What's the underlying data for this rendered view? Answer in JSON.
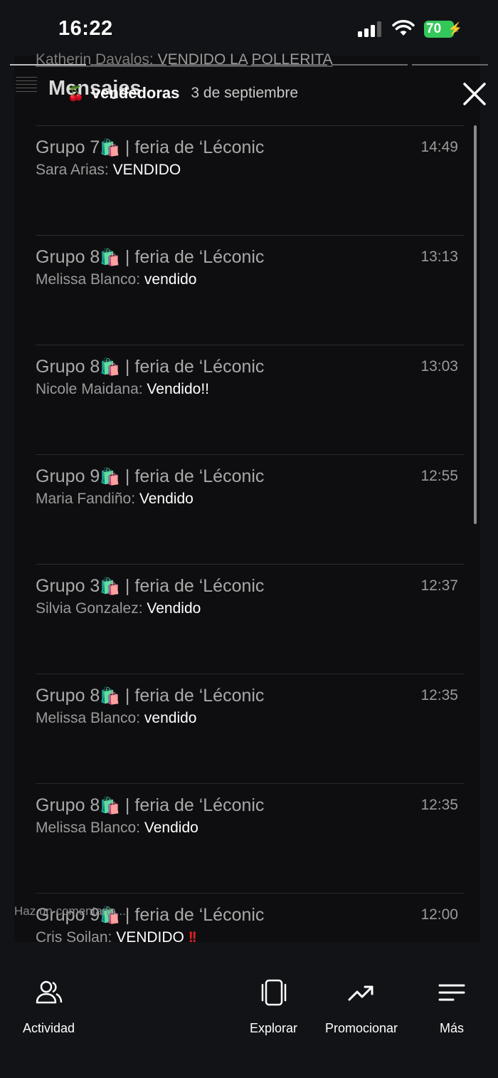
{
  "status": {
    "time": "16:22",
    "battery": "70"
  },
  "background_preview": {
    "sender": "Katherin Davalos:",
    "text": "VENDIDO LA POLLERITA"
  },
  "header": {
    "overlay_title": "Mensajes",
    "group_icon": "🍒",
    "group_name": "vendedoras",
    "date": "3 de septiembre"
  },
  "messages": [
    {
      "group": "Grupo 7",
      "bag": "🛍️",
      "suffix": " | feria de ‘Léconic",
      "time": "14:49",
      "sender": "Sara Arias: ",
      "text": "VENDIDO",
      "mark": ""
    },
    {
      "group": "Grupo 8",
      "bag": "🛍️",
      "suffix": " | feria de ‘Léconic",
      "time": "13:13",
      "sender": "Melissa Blanco: ",
      "text": "vendido",
      "mark": ""
    },
    {
      "group": "Grupo 8",
      "bag": "🛍️",
      "suffix": " | feria de ‘Léconic",
      "time": "13:03",
      "sender": "Nicole Maidana: ",
      "text": "Vendido!!",
      "mark": ""
    },
    {
      "group": "Grupo 9",
      "bag": "🛍️",
      "suffix": " | feria de ‘Léconic",
      "time": "12:55",
      "sender": "Maria Fandiño: ",
      "text": "Vendido",
      "mark": ""
    },
    {
      "group": "Grupo 3",
      "bag": "🛍️",
      "suffix": " | feria de ‘Léconic",
      "time": "12:37",
      "sender": "Silvia Gonzalez: ",
      "text": "Vendido",
      "mark": ""
    },
    {
      "group": "Grupo 8",
      "bag": "🛍️",
      "suffix": " | feria de ‘Léconic",
      "time": "12:35",
      "sender": "Melissa Blanco: ",
      "text": "vendido",
      "mark": ""
    },
    {
      "group": "Grupo 8",
      "bag": "🛍️",
      "suffix": " | feria de ‘Léconic",
      "time": "12:35",
      "sender": "Melissa Blanco: ",
      "text": "Vendido",
      "mark": ""
    },
    {
      "group": "Grupo 9",
      "bag": "🛍️",
      "suffix": " | feria de ‘Léconic",
      "time": "12:00",
      "sender": "Cris Soilan: ",
      "text": "VENDIDO ",
      "mark": "!!"
    }
  ],
  "comment_placeholder": "Haz un comentario...",
  "bottom_nav": [
    {
      "label": "Actividad",
      "icon": "people-icon"
    },
    {
      "label": "Explorar",
      "icon": "cards-icon"
    },
    {
      "label": "Promocionar",
      "icon": "trending-up-icon"
    },
    {
      "label": "Más",
      "icon": "menu-lines-icon"
    }
  ],
  "colors": {
    "background": "#121317",
    "battery": "#34c759",
    "alert": "#e02020"
  }
}
